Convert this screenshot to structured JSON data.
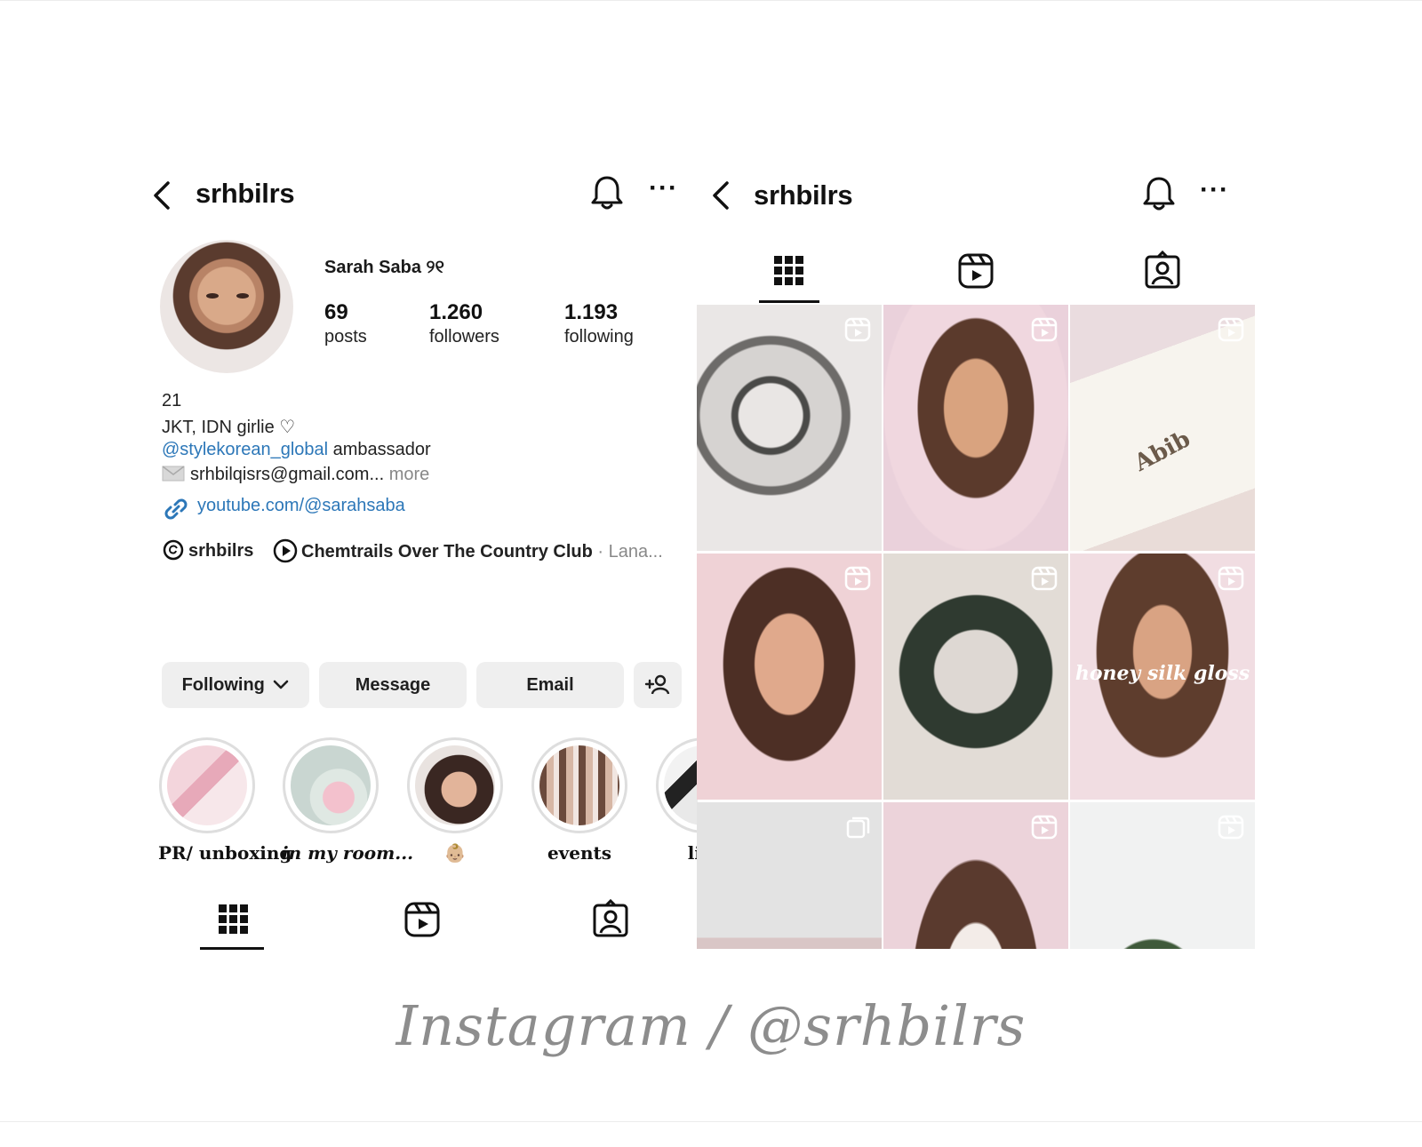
{
  "left": {
    "header": {
      "username": "srhbilrs"
    },
    "profile": {
      "display_name": "Sarah Saba ୨୧",
      "stats": [
        {
          "number": "69",
          "label": "posts"
        },
        {
          "number": "1.260",
          "label": "followers"
        },
        {
          "number": "1.193",
          "label": "following"
        }
      ],
      "bio_age": "21",
      "bio_location": "JKT, IDN girlie ♡",
      "bio_mention": "@stylekorean_global",
      "bio_mention_suffix": " ambassador",
      "bio_email": "srhbilqisrs@gmail.com...",
      "bio_more": "more",
      "link": "youtube.com/@sarahsaba",
      "threads_handle": "srhbilrs",
      "music_title": "Chemtrails Over The Country Club",
      "music_artist": "· Lana..."
    },
    "buttons": {
      "following": "Following",
      "message": "Message",
      "email": "Email"
    },
    "highlights": [
      {
        "label": "PR/ unboxing"
      },
      {
        "label": "in my room..."
      },
      {
        "label": "👶🏼"
      },
      {
        "label": "events"
      },
      {
        "label": "life"
      }
    ]
  },
  "right": {
    "header": {
      "username": "srhbilrs"
    },
    "grid": [
      {
        "type": "reel",
        "overlay": ""
      },
      {
        "type": "reel",
        "overlay": ""
      },
      {
        "type": "reel",
        "overlay": "Abib"
      },
      {
        "type": "reel",
        "overlay": ""
      },
      {
        "type": "reel",
        "overlay": ""
      },
      {
        "type": "reel",
        "overlay": "honey silk gloss"
      },
      {
        "type": "carousel",
        "overlay": ""
      },
      {
        "type": "reel",
        "overlay": ""
      },
      {
        "type": "reel",
        "overlay": ""
      }
    ]
  },
  "caption": "Instagram / @srhbilrs",
  "colors": {
    "link": "#2c77b8",
    "button_bg": "#efefef",
    "caption": "#8d8d8d"
  }
}
